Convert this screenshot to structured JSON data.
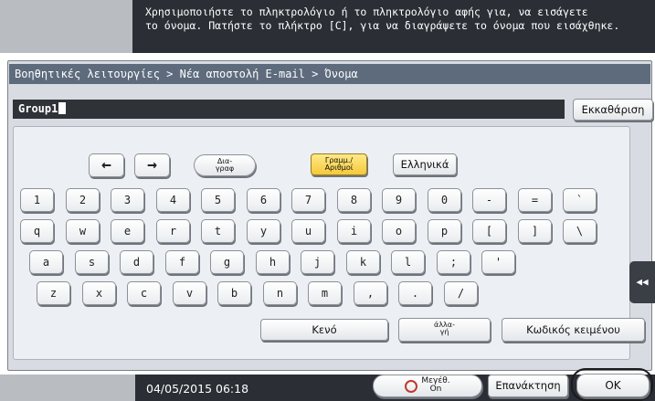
{
  "message": {
    "line1": "Χρησιμοποιήστε το πληκτρολόγιο ή το πληκτρολόγιο αφής για, να εισάγετε",
    "line2": "το όνομα. Πατήστε το πλήκτρο [C], για να διαγράψετε το όνομα που εισάχθηκε."
  },
  "breadcrumb": "Βοηθητικές λειτουργίες > Νέα αποστολή E-mail > Όνομα",
  "name_field": {
    "value": "Group1"
  },
  "clear_label": "Εκκαθάριση",
  "controls": {
    "left_arrow": "←",
    "right_arrow": "→",
    "delete_label_1": "Δια-",
    "delete_label_2": "γραφ",
    "letters_numbers_1": "Γραμμ./",
    "letters_numbers_2": "Αριθμοί",
    "greek_label": "Ελληνικά"
  },
  "keyboard": {
    "row1": [
      "1",
      "2",
      "3",
      "4",
      "5",
      "6",
      "7",
      "8",
      "9",
      "0",
      "-",
      "=",
      "`"
    ],
    "row2": [
      "q",
      "w",
      "e",
      "r",
      "t",
      "y",
      "u",
      "i",
      "o",
      "p",
      "[",
      "]",
      "\\"
    ],
    "row3": [
      "a",
      "s",
      "d",
      "f",
      "g",
      "h",
      "j",
      "k",
      "l",
      ";",
      "'"
    ],
    "row4": [
      "z",
      "x",
      "c",
      "v",
      "b",
      "n",
      "m",
      ",",
      ".",
      "/"
    ]
  },
  "space_label": "Κενό",
  "change_label_1": "άλλα-",
  "change_label_2": "γή",
  "text_code_label": "Κωδικός κειμένου",
  "side_tab_glyph": "◀◀",
  "bottom": {
    "datetime": "04/05/2015   06:18",
    "zoom_1": "Μεγέθ.",
    "zoom_2": "On",
    "reset_label": "Επανάκτηση",
    "ok_label": "OK"
  }
}
